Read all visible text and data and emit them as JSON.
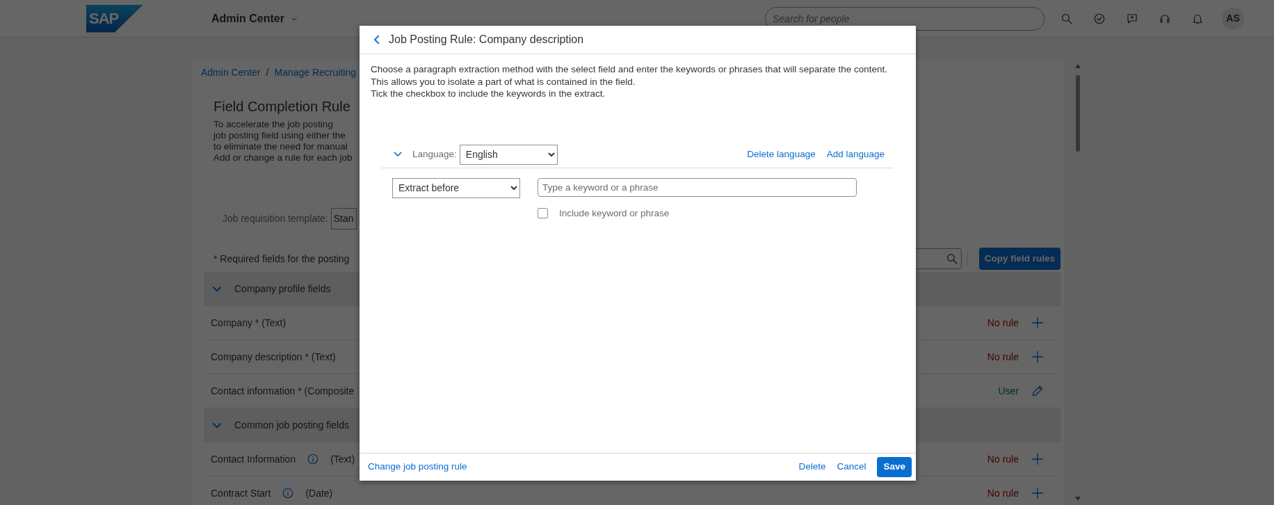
{
  "header": {
    "logo": "SAP",
    "app_title": "Admin Center",
    "search": {
      "placeholder": "Search for people"
    },
    "avatar": "AS"
  },
  "page": {
    "breadcrumb": [
      "Admin Center",
      "Manage Recruiting"
    ],
    "breadcrumb_separator": "/",
    "title": "Field Completion Rule",
    "description": [
      "To accelerate the job posting",
      "job posting field using either the",
      "to eliminate the need for manual",
      "Add or change a rule for each job"
    ],
    "template": {
      "label": "Job requisition template:",
      "value": "Stan"
    },
    "required_note": "* Required fields for the posting",
    "copy_button": "Copy field rules",
    "groups": [
      {
        "title": "Company profile fields",
        "expanded": true,
        "fields": [
          {
            "name": "Company *",
            "type": "(Text)",
            "info": false,
            "kind": "none",
            "status": "No rule"
          },
          {
            "name": "Company description *",
            "type": "(Text)",
            "info": false,
            "kind": "none",
            "status": "No rule"
          },
          {
            "name": "Contact information *",
            "type": "(Composite",
            "info": false,
            "kind": "user",
            "status": "User"
          }
        ]
      },
      {
        "title": "Common job posting fields",
        "expanded": true,
        "fields": [
          {
            "name": "Contact Information",
            "type": "(Text)",
            "info": true,
            "kind": "none",
            "status": "No rule"
          },
          {
            "name": "Contract Start",
            "type": "(Date)",
            "info": true,
            "kind": "none",
            "status": "No rule"
          }
        ]
      }
    ]
  },
  "dialog": {
    "title": "Job Posting Rule: Company description",
    "description": [
      "Choose a paragraph extraction method with the select field and enter the keywords or phrases that will separate the content.",
      "This allows you to isolate a part of what is contained in the field.",
      "Tick the checkbox to include the keywords in the extract."
    ],
    "language": {
      "label": "Language:",
      "value": "English",
      "expanded": true
    },
    "delete_language": "Delete language",
    "add_language": "Add language",
    "method": "Extract before",
    "keyword": {
      "placeholder": "Type a keyword or a phrase"
    },
    "include": {
      "label": "Include keyword or phrase",
      "checked": false
    },
    "footer_link": "Change job posting rule",
    "buttons": [
      "Delete",
      "Cancel",
      "Save"
    ]
  }
}
